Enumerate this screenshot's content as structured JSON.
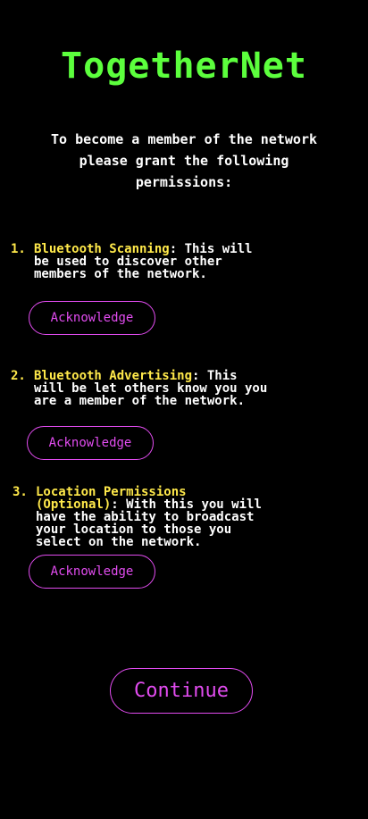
{
  "app": {
    "title": "TogetherNet"
  },
  "intro": {
    "text": "To become a member of the network\nplease grant the following\npermissions:"
  },
  "permissions": [
    {
      "number": "1.",
      "title": "Bluetooth Scanning",
      "description": ": This will\nbe used to discover other\nmembers of the network.",
      "button_label": "Acknowledge"
    },
    {
      "number": "2.",
      "title": "Bluetooth Advertising",
      "description": ": This\nwill be let others know you you\nare a member of the network.",
      "button_label": "Acknowledge"
    },
    {
      "number": "3.",
      "title": "Location Permissions\n(Optional)",
      "description": ": With this you will\nhave the ability to broadcast\nyour location to those you\nselect on the network.",
      "button_label": "Acknowledge"
    }
  ],
  "continue_label": "Continue",
  "colors": {
    "background": "#000000",
    "title": "#5cff3d",
    "permission_title": "#ffe94a",
    "button": "#e24cf0",
    "text": "#ffffff"
  }
}
